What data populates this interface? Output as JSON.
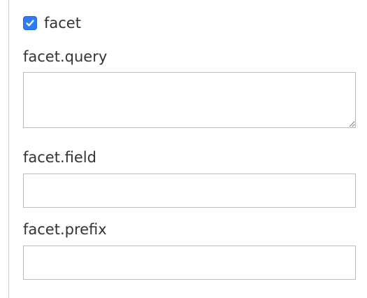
{
  "facet": {
    "checkbox": {
      "label": "facet",
      "checked": true,
      "accent_color": "#2b7cf6"
    },
    "fields": {
      "query": {
        "label": "facet.query",
        "value": "",
        "placeholder": ""
      },
      "field": {
        "label": "facet.field",
        "value": "",
        "placeholder": ""
      },
      "prefix": {
        "label": "facet.prefix",
        "value": "",
        "placeholder": ""
      }
    }
  }
}
